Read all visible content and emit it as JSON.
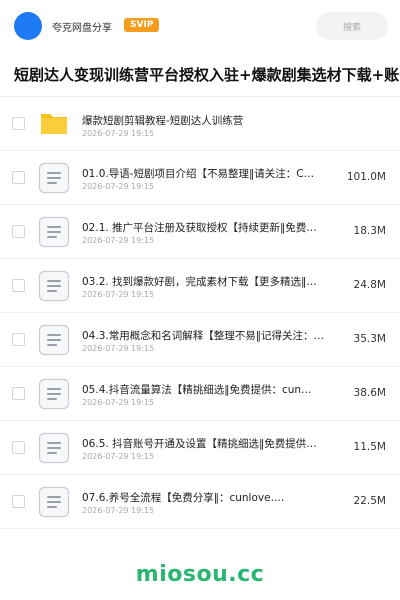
{
  "header": {
    "username": "夸克网盘分享",
    "badge": "SVIP",
    "search_placeholder": "搜索"
  },
  "share": {
    "title": "短剧达人变现训练营平台授权入驻+爆款剧集选材下载+账号"
  },
  "items": [
    {
      "type": "folder",
      "name": "爆款短剧剪辑教程-短剧达人训练营",
      "date": "2026-07-29 19:15",
      "size": ""
    },
    {
      "type": "file",
      "name": "01.0.导语-短剧项目介绍【不易整理‖请关注：C…",
      "date": "2026-07-29 19:15",
      "size": "101.0M"
    },
    {
      "type": "file",
      "name": "02.1. 推广平台注册及获取授权【持续更新‖免费…",
      "date": "2026-07-29 19:15",
      "size": "18.3M"
    },
    {
      "type": "file",
      "name": "03.2. 找到爆款好剧，完成素材下载【更多精选‖…",
      "date": "2026-07-29 19:15",
      "size": "24.8M"
    },
    {
      "type": "file",
      "name": "04.3.常用概念和名词解释【整理不易‖记得关注：…",
      "date": "2026-07-29 19:15",
      "size": "35.3M"
    },
    {
      "type": "file",
      "name": "05.4.抖音流量算法【精挑细选‖免费提供：cun…",
      "date": "2026-07-29 19:15",
      "size": "38.6M"
    },
    {
      "type": "file",
      "name": "06.5. 抖音账号开通及设置【精挑细选‖免费提供…",
      "date": "2026-07-29 19:15",
      "size": "11.5M"
    },
    {
      "type": "file",
      "name": "07.6.养号全流程【免费分享‖：cunlove.…",
      "date": "2026-07-29 19:15",
      "size": "22.5M"
    }
  ],
  "watermark": "miosou.cc",
  "colors": {
    "avatar": "#1f7bf5",
    "badge": "#f39c1f",
    "folder": "#f9c11c",
    "watermark": "#2bb573"
  }
}
